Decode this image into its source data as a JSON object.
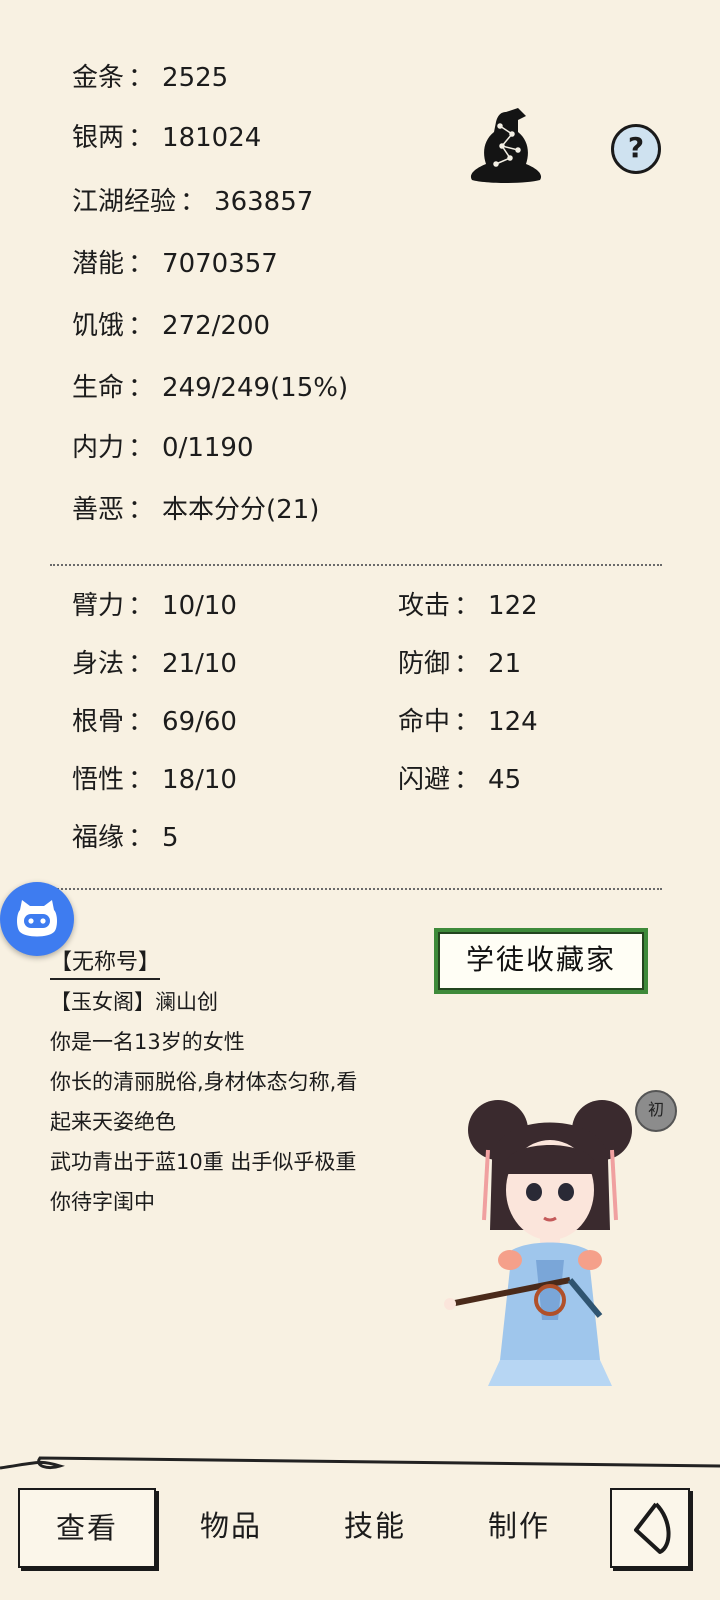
{
  "stats_main": [
    {
      "label": "金条",
      "sep": "：",
      "value": "2525"
    },
    {
      "label": "银两",
      "sep": "：",
      "value": "181024"
    },
    {
      "label": "江湖经验",
      "sep": "：",
      "value": "363857"
    },
    {
      "label": "潜能",
      "sep": "：",
      "value": "7070357"
    },
    {
      "label": "饥饿",
      "sep": "：",
      "value": "272/200"
    },
    {
      "label": "生命",
      "sep": "：",
      "value": "249/249(15%)"
    },
    {
      "label": "内力",
      "sep": "：",
      "value": "0/1190"
    },
    {
      "label": "善恶",
      "sep": "：",
      "value": "本本分分(21)"
    }
  ],
  "attributes": [
    {
      "label": "臂力",
      "sep": "：",
      "value": "10/10"
    },
    {
      "label": "身法",
      "sep": "：",
      "value": "21/10"
    },
    {
      "label": "根骨",
      "sep": "：",
      "value": "69/60"
    },
    {
      "label": "悟性",
      "sep": "：",
      "value": "18/10"
    },
    {
      "label": "福缘",
      "sep": "：",
      "value": "5"
    }
  ],
  "combat": [
    {
      "label": "攻击",
      "sep": "：",
      "value": "122"
    },
    {
      "label": "防御",
      "sep": "：",
      "value": "21"
    },
    {
      "label": "命中",
      "sep": "：",
      "value": "124"
    },
    {
      "label": "闪避",
      "sep": "：",
      "value": "45"
    }
  ],
  "bio": {
    "title": "【无称号】",
    "sect": "【玉女阁】澜山创",
    "lines": [
      "你是一名13岁的女性",
      "你长的清丽脱俗,身材体态匀称,看",
      "起来天姿绝色",
      "武功青出于蓝10重 出手似乎极重",
      "你待字闺中"
    ]
  },
  "badge": "学徒收藏家",
  "rank_label": "初",
  "help_symbol": "?",
  "nav": {
    "tabs": [
      {
        "label": "查看",
        "active": true
      },
      {
        "label": "物品",
        "active": false
      },
      {
        "label": "技能",
        "active": false
      },
      {
        "label": "制作",
        "active": false
      }
    ]
  },
  "colors": {
    "background": "#f8f1e2",
    "help_bg": "#cfe2f0",
    "bot_bg": "#3e7cf0",
    "badge_green": "#3e8a3a",
    "dress_blue": "#9fc6ec"
  },
  "icons": [
    "meditation-silhouette-icon",
    "help-icon",
    "assistant-bot-icon",
    "back-icon"
  ]
}
